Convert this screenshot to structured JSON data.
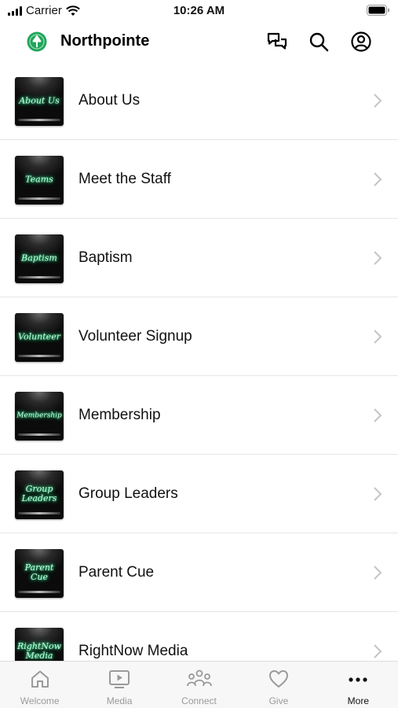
{
  "status": {
    "carrier": "Carrier",
    "time": "10:26 AM"
  },
  "header": {
    "title": "Northpointe",
    "logo_icon": "leaf-logo-icon",
    "brand_color": "#1fa65a",
    "actions": [
      "messages-icon",
      "search-icon",
      "profile-icon"
    ]
  },
  "menu": {
    "items": [
      {
        "label": "About Us",
        "thumb_text": "About Us"
      },
      {
        "label": "Meet the Staff",
        "thumb_text": "Teams"
      },
      {
        "label": "Baptism",
        "thumb_text": "Baptism"
      },
      {
        "label": "Volunteer Signup",
        "thumb_text": "Volunteer"
      },
      {
        "label": "Membership",
        "thumb_text": "Membership"
      },
      {
        "label": "Group Leaders",
        "thumb_text": "Group Leaders"
      },
      {
        "label": "Parent Cue",
        "thumb_text": "Parent Cue"
      },
      {
        "label": "RightNow Media",
        "thumb_text": "RightNow Media"
      }
    ]
  },
  "tabs": [
    {
      "label": "Welcome",
      "icon": "home-icon",
      "active": false
    },
    {
      "label": "Media",
      "icon": "tv-play-icon",
      "active": false
    },
    {
      "label": "Connect",
      "icon": "people-icon",
      "active": false
    },
    {
      "label": "Give",
      "icon": "heart-icon",
      "active": false
    },
    {
      "label": "More",
      "icon": "more-dots-icon",
      "active": true
    }
  ]
}
